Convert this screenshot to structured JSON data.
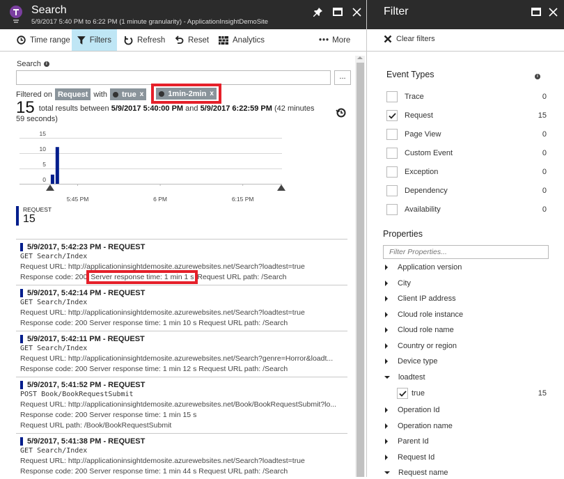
{
  "search_blade": {
    "title": "Search",
    "subtitle": "5/9/2017 5:40 PM to 6:22 PM (1 minute granularity) - ApplicationInsightDemoSite",
    "toolbar": {
      "time_range": "Time range",
      "filters": "Filters",
      "refresh": "Refresh",
      "reset": "Reset",
      "analytics": "Analytics",
      "more": "More"
    },
    "search": {
      "label": "Search",
      "value": "",
      "placeholder": "",
      "options_button": "..."
    },
    "filtered_on": {
      "prefix": "Filtered on",
      "event_type": "Request",
      "with": "with",
      "chips": [
        {
          "label": "true",
          "remove": "x"
        },
        {
          "label": "1min-2min",
          "remove": "x",
          "highlighted": true
        }
      ]
    },
    "summary": {
      "count": "15",
      "text_before": "total results between",
      "start": "5/9/2017 5:40:00 PM",
      "and": "and",
      "end": "5/9/2017 6:22:59 PM",
      "duration": "(42 minutes 59 seconds)"
    },
    "legend": {
      "label": "REQUEST",
      "value": "15"
    },
    "results": [
      {
        "header": "5/9/2017, 5:42:23 PM - REQUEST",
        "operation": "GET Search/Index",
        "url": "Request URL: http://applicationinsightdemosite.azurewebsites.net/Search?loadtest=true",
        "response_code": "Response code: 200",
        "response_time": "Server response time: 1 min 1 s",
        "url_path": "Request URL path: /Search",
        "highlight_response_time": true
      },
      {
        "header": "5/9/2017, 5:42:14 PM - REQUEST",
        "operation": "GET Search/Index",
        "url": "Request URL: http://applicationinsightdemosite.azurewebsites.net/Search?loadtest=true",
        "response_code": "Response code: 200",
        "response_time": "Server response time: 1 min 10 s",
        "url_path": "Request URL path: /Search"
      },
      {
        "header": "5/9/2017, 5:42:11 PM - REQUEST",
        "operation": "GET Search/Index",
        "url": "Request URL: http://applicationinsightdemosite.azurewebsites.net/Search?genre=Horror&loadt...",
        "response_code": "Response code: 200",
        "response_time": "Server response time: 1 min 12 s",
        "url_path": "Request URL path: /Search"
      },
      {
        "header": "5/9/2017, 5:41:52 PM - REQUEST",
        "operation": "POST Book/BookRequestSubmit",
        "url": "Request URL: http://applicationinsightdemosite.azurewebsites.net/Book/BookRequestSubmit?lo...",
        "response_code": "Response code: 200",
        "response_time": "Server response time: 1 min 15 s",
        "url_path": "Request URL path: /Book/BookRequestSubmit",
        "path_on_new_line": true
      },
      {
        "header": "5/9/2017, 5:41:38 PM - REQUEST",
        "operation": "GET Search/Index",
        "url": "Request URL: http://applicationinsightdemosite.azurewebsites.net/Search?loadtest=true",
        "response_code": "Response code: 200",
        "response_time": "Server response time: 1 min 44 s",
        "url_path": "Request URL path: /Search"
      }
    ]
  },
  "chart_data": {
    "type": "bar",
    "title": "",
    "xlabel": "",
    "ylabel": "",
    "x_ticks": [
      "5:45 PM",
      "6 PM",
      "6:15 PM"
    ],
    "y_ticks": [
      0,
      5,
      10,
      15
    ],
    "ylim": [
      0,
      15
    ],
    "x_range": [
      "5:40 PM",
      "6:22 PM"
    ],
    "series": [
      {
        "name": "REQUEST",
        "color": "#001d8c",
        "x": [
          "5:41 PM",
          "5:42 PM"
        ],
        "values": [
          3,
          12
        ]
      }
    ],
    "grid": true,
    "legend": "bottom-left"
  },
  "filter_blade": {
    "title": "Filter",
    "clear_filters": "Clear filters",
    "event_types_title": "Event Types",
    "event_types": [
      {
        "label": "Trace",
        "count": "0",
        "checked": false
      },
      {
        "label": "Request",
        "count": "15",
        "checked": true
      },
      {
        "label": "Page View",
        "count": "0",
        "checked": false
      },
      {
        "label": "Custom Event",
        "count": "0",
        "checked": false
      },
      {
        "label": "Exception",
        "count": "0",
        "checked": false
      },
      {
        "label": "Dependency",
        "count": "0",
        "checked": false
      },
      {
        "label": "Availability",
        "count": "0",
        "checked": false
      }
    ],
    "properties_title": "Properties",
    "filter_placeholder": "Filter Properties...",
    "properties": [
      {
        "label": "Application version",
        "expanded": false
      },
      {
        "label": "City",
        "expanded": false
      },
      {
        "label": "Client IP address",
        "expanded": false
      },
      {
        "label": "Cloud role instance",
        "expanded": false
      },
      {
        "label": "Cloud role name",
        "expanded": false
      },
      {
        "label": "Country or region",
        "expanded": false
      },
      {
        "label": "Device type",
        "expanded": false
      },
      {
        "label": "loadtest",
        "expanded": true,
        "values": [
          {
            "label": "true",
            "count": "15",
            "checked": true
          }
        ]
      },
      {
        "label": "Operation Id",
        "expanded": false
      },
      {
        "label": "Operation name",
        "expanded": false
      },
      {
        "label": "Parent Id",
        "expanded": false
      },
      {
        "label": "Request Id",
        "expanded": false
      },
      {
        "label": "Request name",
        "expanded": true
      }
    ]
  },
  "colors": {
    "titlebar": "#2b2b2b",
    "active_tool": "#bfe6f5",
    "chip": "#8a949b",
    "highlight_box": "#e5202a",
    "series": "#001d8c"
  }
}
